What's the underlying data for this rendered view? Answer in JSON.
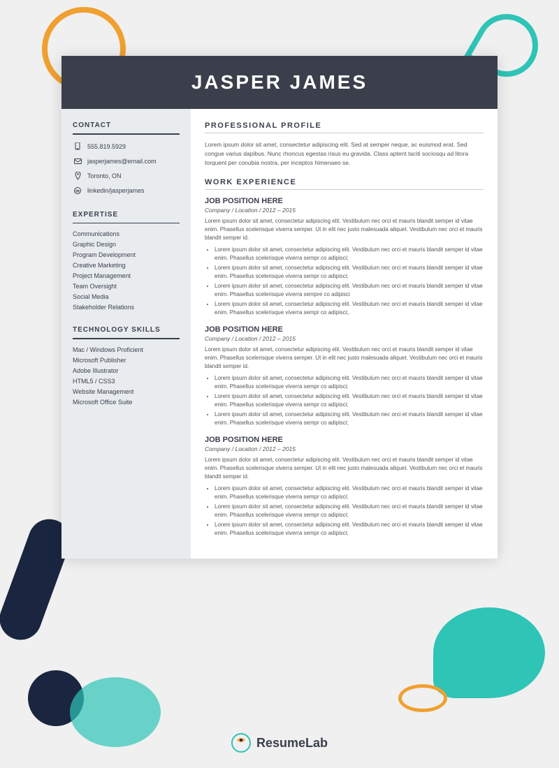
{
  "background": {
    "color": "#f0f0f0"
  },
  "header": {
    "name": "JASPER JAMES"
  },
  "contact": {
    "section_title": "CONTACT",
    "phone": "555.819.5929",
    "email": "jasperjames@email.com",
    "location": "Toronto, ON",
    "linkedin": "linkedin/jasperjames"
  },
  "expertise": {
    "section_title": "EXPERTISE",
    "items": [
      "Communications",
      "Graphic Design",
      "Program Development",
      "Creative Marketing",
      "Project Management",
      "Team Oversight",
      "Social Media",
      "Stakeholder Relations"
    ]
  },
  "technology": {
    "section_title": "TECHNOLOGY SKILLS",
    "items": [
      "Mac / Windows Proficient",
      "Microsoft Publisher",
      "Adobe Illustrator",
      "HTML5 / CSS3",
      "Website Management",
      "Microsoft Office Suite"
    ]
  },
  "profile": {
    "section_title": "PROFESSIONAL PROFILE",
    "text": "Lorem ipsum dolor sit amet, consectetur adipiscing elit. Sed at semper neque, ac euismod erat. Sed congue varius dapibus. Nunc rhoncus egestas risus eu gravida. Class aptent taciti sociosqu ad litora torquent per conubia nostra, per inceptos himenaeo se."
  },
  "work_experience": {
    "section_title": "WORK EXPERIENCE",
    "jobs": [
      {
        "title": "JOB POSITION HERE",
        "company": "Company / Location / 2012 – 2015",
        "description": "Lorem ipsum dolor sit amet, consectetur adipiscing elit. Vestibulum nec orci et mauris blandit semper id vitae enim. Phasellus scelerisque viverra semper. Ut in elit nec justo malesuada aliquet. Vestibulum nec orci et mauris blandit semper id.",
        "bullets": [
          "Lorem ipsum dolor sit amet, consectetur adipiscing elit. Vestibulum nec orci et mauris blandit semper id vitae enim. Phasellus scelerisque viverra sempr co adipisci;",
          "Lorem ipsum dolor sit amet, consectetur adipiscing elit. Vestibulum nec orci et mauris blandit semper id vitae enim. Phasellus scelerisque viverra sempr co adipisci;",
          "Lorem ipsum dolor sit amet, consectetur adipiscing elit. Vestibulum nec orci et mauris blandit semper id vitae enim. Phasellus scelerisque viverra sempre co adipisci",
          "Lorem ipsum dolor sit amet, consectetur adipiscing elit. Vestibulum nec orci et mauris blandit semper id vitae enim. Phasellus scelerisque viverra sempr co adipisci;."
        ]
      },
      {
        "title": "JOB POSITION HERE",
        "company": "Company / Location /  2012 – 2015",
        "description": "Lorem ipsum dolor sit amet, consectetur adipiscing elit. Vestibulum nec orci et mauris blandit semper id vitae enim. Phasellus scelerisque viverra semper. Ut in elit nec justo malesuada aliquet. Vestibulum nec orci et mauris blandit semper id.",
        "bullets": [
          "Lorem ipsum dolor sit amet, consectetur adipiscing elit. Vestibulum nec orci et mauris blandit semper id vitae enim. Phasellus scelerisque viverra sempr co adipisci;",
          "Lorem ipsum dolor sit amet, consectetur adipiscing elit. Vestibulum nec orci et mauris blandit semper id vitae enim. Phasellus scelerisque viverra sempr co adipisci;",
          "Lorem ipsum dolor sit amet, consectetur adipiscing elit. Vestibulum nec orci et mauris blandit semper id vitae enim. Phasellus scelerisque viverra sempr co adipisci;"
        ]
      },
      {
        "title": "JOB POSITION HERE",
        "company": "Company / Location / 2012 – 2015",
        "description": "Lorem ipsum dolor sit amet, consectetur adipiscing elit. Vestibulum nec orci et mauris blandit semper id vitae enim. Phasellus scelerisque viverra semper. Ut in elit nec justo malesuada aliquet. Vestibulum nec orci et mauris blandit semper id.",
        "bullets": [
          "Lorem ipsum dolor sit amet, consectetur adipiscing elit. Vestibulum nec orci et mauris blandit semper id vitae enim. Phasellus scelerisque viverra sempr co adipisci;",
          "Lorem ipsum dolor sit amet, consectetur adipiscing elit. Vestibulum nec orci et mauris blandit semper id vitae enim. Phasellus scelerisque viverra sempr co adipisci;",
          "Lorem ipsum dolor sit amet, consectetur adipiscing elit. Vestibulum nec orci et mauris blandit semper id vitae enim. Phasellus scelerisque viverra sempr co adipisci;"
        ]
      }
    ]
  },
  "branding": {
    "name_regular": "Resume",
    "name_bold": "Lab"
  }
}
